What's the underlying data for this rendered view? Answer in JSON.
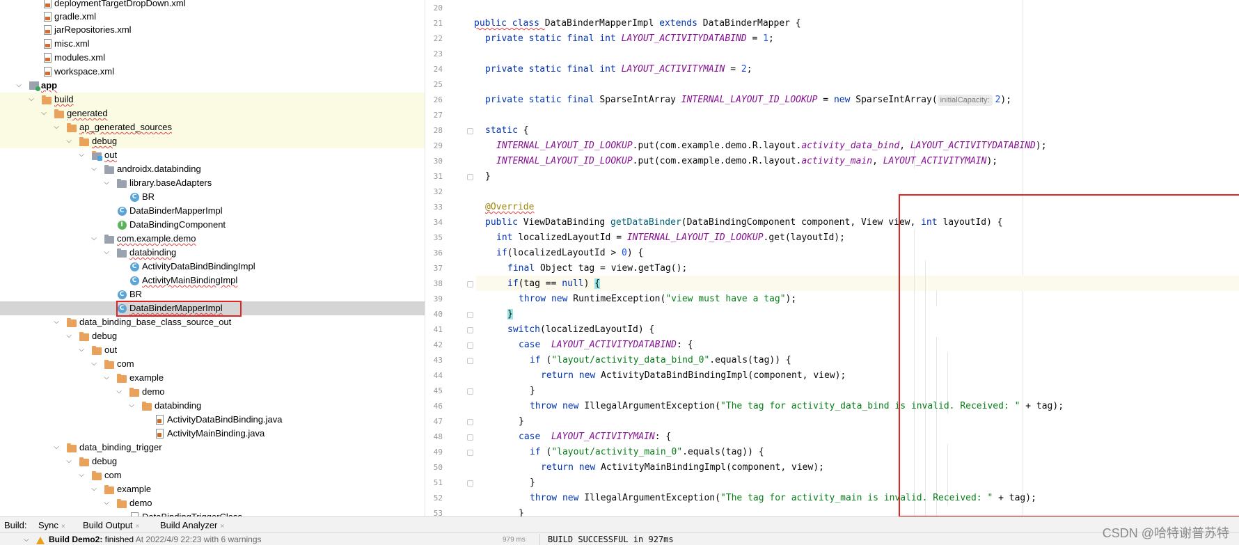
{
  "tree": {
    "items": [
      {
        "label": "deploymentTargetDropDown.xml",
        "icon": "xml-file-icon"
      },
      {
        "label": "gradle.xml",
        "icon": "xml-file-icon"
      },
      {
        "label": "jarRepositories.xml",
        "icon": "xml-file-icon"
      },
      {
        "label": "misc.xml",
        "icon": "xml-file-icon"
      },
      {
        "label": "modules.xml",
        "icon": "xml-file-icon"
      },
      {
        "label": "workspace.xml",
        "icon": "xml-file-icon"
      },
      {
        "label": "app",
        "icon": "module-icon"
      },
      {
        "label": "build",
        "icon": "folder-icon"
      },
      {
        "label": "generated",
        "icon": "folder-icon"
      },
      {
        "label": "ap_generated_sources",
        "icon": "folder-icon"
      },
      {
        "label": "debug",
        "icon": "folder-icon"
      },
      {
        "label": "out",
        "icon": "source-folder-icon"
      },
      {
        "label": "androidx.databinding",
        "icon": "package-icon"
      },
      {
        "label": "library.baseAdapters",
        "icon": "package-icon"
      },
      {
        "label": "BR",
        "icon": "class-icon"
      },
      {
        "label": "DataBinderMapperImpl",
        "icon": "class-icon"
      },
      {
        "label": "DataBindingComponent",
        "icon": "interface-icon"
      },
      {
        "label": "com.example.demo",
        "icon": "package-icon"
      },
      {
        "label": "databinding",
        "icon": "package-icon"
      },
      {
        "label": "ActivityDataBindBindingImpl",
        "icon": "class-icon"
      },
      {
        "label": "ActivityMainBindingImpl",
        "icon": "class-icon"
      },
      {
        "label": "BR",
        "icon": "class-icon"
      },
      {
        "label": "DataBinderMapperImpl",
        "icon": "class-icon"
      },
      {
        "label": "data_binding_base_class_source_out",
        "icon": "folder-icon"
      },
      {
        "label": "debug",
        "icon": "folder-icon"
      },
      {
        "label": "out",
        "icon": "folder-icon"
      },
      {
        "label": "com",
        "icon": "folder-icon"
      },
      {
        "label": "example",
        "icon": "folder-icon"
      },
      {
        "label": "demo",
        "icon": "folder-icon"
      },
      {
        "label": "databinding",
        "icon": "folder-icon"
      },
      {
        "label": "ActivityDataBindBinding.java",
        "icon": "java-file-icon"
      },
      {
        "label": "ActivityMainBinding.java",
        "icon": "java-file-icon"
      },
      {
        "label": "data_binding_trigger",
        "icon": "folder-icon"
      },
      {
        "label": "debug",
        "icon": "folder-icon"
      },
      {
        "label": "com",
        "icon": "folder-icon"
      },
      {
        "label": "example",
        "icon": "folder-icon"
      },
      {
        "label": "demo",
        "icon": "folder-icon"
      },
      {
        "label": "DataBindingTriggerClass",
        "icon": "java-file-icon"
      }
    ]
  },
  "editor": {
    "line_numbers": [
      "20",
      "21",
      "22",
      "23",
      "24",
      "25",
      "26",
      "27",
      "28",
      "29",
      "30",
      "31",
      "32",
      "33",
      "34",
      "35",
      "36",
      "37",
      "38",
      "39",
      "40",
      "41",
      "42",
      "43",
      "44",
      "45",
      "46",
      "47",
      "48",
      "49",
      "50",
      "51",
      "52",
      "53"
    ],
    "hint_initial_capacity": "initialCapacity:",
    "code": {
      "l21_a": "public class ",
      "l21_b": "DataBinderMapperImpl ",
      "l21_c": "extends ",
      "l21_d": "DataBinderMapper {",
      "l22_a": "private static final int ",
      "l22_b": "LAYOUT_ACTIVITYDATABIND",
      "l22_c": " = ",
      "l22_d": "1",
      "l22_e": ";",
      "l24_a": "private static final int ",
      "l24_b": "LAYOUT_ACTIVITYMAIN",
      "l24_c": " = ",
      "l24_d": "2",
      "l24_e": ";",
      "l26_a": "private static final ",
      "l26_b": "SparseIntArray ",
      "l26_c": "INTERNAL_LAYOUT_ID_LOOKUP",
      "l26_d": " = ",
      "l26_e": "new ",
      "l26_f": "SparseIntArray(",
      "l26_g": "2",
      "l26_h": ");",
      "l28_a": "static ",
      "l28_b": "{",
      "l29_a": "INTERNAL_LAYOUT_ID_LOOKUP",
      "l29_b": ".put(com.example.demo.R.layout.",
      "l29_c": "activity_data_bind",
      "l29_d": ", ",
      "l29_e": "LAYOUT_ACTIVITYDATABIND",
      "l29_f": ");",
      "l30_a": "INTERNAL_LAYOUT_ID_LOOKUP",
      "l30_b": ".put(com.example.demo.R.layout.",
      "l30_c": "activity_main",
      "l30_d": ", ",
      "l30_e": "LAYOUT_ACTIVITYMAIN",
      "l30_f": ");",
      "l31_a": "}",
      "l33_a": "@Override",
      "l34_a": "public ",
      "l34_b": "ViewDataBinding ",
      "l34_c": "getDataBinder",
      "l34_d": "(DataBindingComponent component, View view, ",
      "l34_e": "int ",
      "l34_f": "layoutId) {",
      "l35_a": "int ",
      "l35_b": "localizedLayoutId = ",
      "l35_c": "INTERNAL_LAYOUT_ID_LOOKUP",
      "l35_d": ".get(layoutId);",
      "l36_a": "if",
      "l36_b": "(localizedLayoutId > ",
      "l36_c": "0",
      "l36_d": ") {",
      "l37_a": "final ",
      "l37_b": "Object tag = view.getTag();",
      "l38_a": "if",
      "l38_b": "(tag == ",
      "l38_c": "null",
      "l38_d": ") ",
      "l38_e": "{",
      "l39_a": "throw new ",
      "l39_b": "RuntimeException(",
      "l39_c": "\"view must have a tag\"",
      "l39_d": ");",
      "l40_a": "}",
      "l41_a": "switch",
      "l41_b": "(localizedLayoutId) {",
      "l42_a": "case  ",
      "l42_b": "LAYOUT_ACTIVITYDATABIND",
      "l42_c": ": {",
      "l43_a": "if ",
      "l43_b": "(",
      "l43_c": "\"layout/activity_data_bind_0\"",
      "l43_d": ".equals(tag)) {",
      "l44_a": "return new ",
      "l44_b": "ActivityDataBindBindingImpl(component, view);",
      "l45_a": "}",
      "l46_a": "throw new ",
      "l46_b": "IllegalArgumentException(",
      "l46_c": "\"The tag for activity_data_bind is invalid. Received: \"",
      "l46_d": " + tag);",
      "l47_a": "}",
      "l48_a": "case  ",
      "l48_b": "LAYOUT_ACTIVITYMAIN",
      "l48_c": ": {",
      "l49_a": "if ",
      "l49_b": "(",
      "l49_c": "\"layout/activity_main_0\"",
      "l49_d": ".equals(tag)) {",
      "l50_a": "return new ",
      "l50_b": "ActivityMainBindingImpl(component, view);",
      "l51_a": "}",
      "l52_a": "throw new ",
      "l52_b": "IllegalArgumentException(",
      "l52_c": "\"The tag for activity_main is invalid. Received: \"",
      "l52_d": " + tag);",
      "l53_a": "}"
    }
  },
  "bottom": {
    "build_label": "Build:",
    "tabs": [
      {
        "label": "Sync",
        "close": "×"
      },
      {
        "label": "Build Output",
        "close": "×"
      },
      {
        "label": "Build Analyzer",
        "close": "×"
      }
    ],
    "build_status_bold": "Build Demo2:",
    "build_status_rest": " finished ",
    "build_time": "At 2022/4/9 22:23 with 6 warnings",
    "build_duration": "979 ms",
    "console_output": "BUILD SUCCESSFUL in 927ms",
    "watermark": "CSDN @哈特谢普苏特"
  },
  "colors": {
    "keyword": "#0033b3",
    "constant": "#871094",
    "string": "#067d17",
    "number": "#1750eb",
    "annotation": "#9e880d",
    "highlight_box": "#e02424",
    "tree_highlight": "#fbfbe3",
    "tree_selection": "#d5d5d5"
  }
}
